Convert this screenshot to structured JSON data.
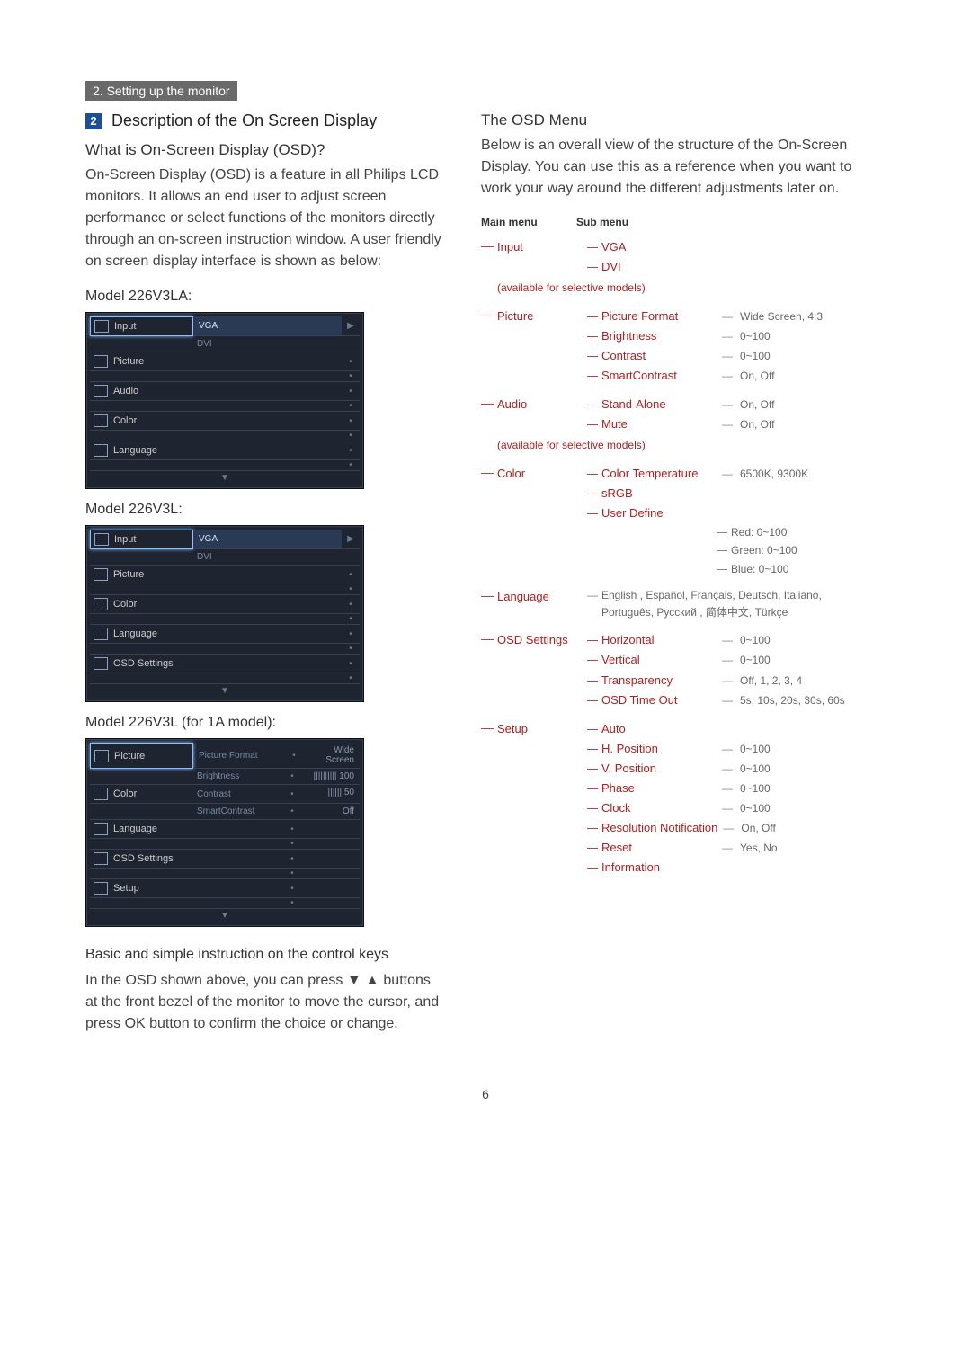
{
  "header": "2. Setting up the monitor",
  "section_number": "2",
  "section_title": "Description of the On Screen Display",
  "left": {
    "q_heading": "What is On-Screen Display (OSD)?",
    "q_body": "On-Screen Display (OSD) is a feature in all Philips LCD monitors. It allows an end user to adjust screen performance or select functions of the monitors directly through an on-screen instruction window. A user friendly on screen display interface is shown as below:",
    "model_a": "Model 226V3LA:",
    "model_b": "Model 226V3L:",
    "model_c": "Model 226V3L (for 1A model):",
    "osd_a": {
      "rows": [
        {
          "icon": true,
          "label": "Input",
          "right": "VGA",
          "active": true
        },
        {
          "icon": false,
          "label": "",
          "right": "DVI"
        },
        {
          "icon": true,
          "label": "Picture",
          "right": ""
        },
        {
          "icon": false,
          "label": "",
          "right": ""
        },
        {
          "icon": true,
          "label": "Audio",
          "right": ""
        },
        {
          "icon": false,
          "label": "",
          "right": ""
        },
        {
          "icon": true,
          "label": "Color",
          "right": ""
        },
        {
          "icon": false,
          "label": "",
          "right": ""
        },
        {
          "icon": true,
          "label": "Language",
          "right": ""
        },
        {
          "icon": false,
          "label": "",
          "right": ""
        }
      ]
    },
    "osd_b": {
      "rows": [
        {
          "icon": true,
          "label": "Input",
          "right": "VGA",
          "active": true
        },
        {
          "icon": false,
          "label": "",
          "right": "DVI"
        },
        {
          "icon": true,
          "label": "Picture",
          "right": ""
        },
        {
          "icon": false,
          "label": "",
          "right": ""
        },
        {
          "icon": true,
          "label": "Color",
          "right": ""
        },
        {
          "icon": false,
          "label": "",
          "right": ""
        },
        {
          "icon": true,
          "label": "Language",
          "right": ""
        },
        {
          "icon": false,
          "label": "",
          "right": ""
        },
        {
          "icon": true,
          "label": "OSD Settings",
          "right": ""
        },
        {
          "icon": false,
          "label": "",
          "right": ""
        }
      ]
    },
    "osd_c": {
      "rows": [
        {
          "left": "Picture",
          "r1": "Picture Format",
          "val": "Wide Screen",
          "active": true
        },
        {
          "left": "",
          "r1": "Brightness",
          "val": "||||||||||  100"
        },
        {
          "left": "Color",
          "r1": "Contrast",
          "val": "||||||          50"
        },
        {
          "left": "",
          "r1": "SmartContrast",
          "val": "Off"
        },
        {
          "left": "Language",
          "r1": "",
          "val": ""
        },
        {
          "left": "",
          "r1": "",
          "val": ""
        },
        {
          "left": "OSD Settings",
          "r1": "",
          "val": ""
        },
        {
          "left": "",
          "r1": "",
          "val": ""
        },
        {
          "left": "Setup",
          "r1": "",
          "val": ""
        },
        {
          "left": "",
          "r1": "",
          "val": ""
        }
      ]
    },
    "instr_heading": "Basic and simple instruction on the control keys",
    "instr_body_1": "In the OSD shown above, you can press ▼",
    "instr_body_2": "▲ buttons at the front bezel of the monitor to move the cursor, and press OK button to confirm the choice or change."
  },
  "right": {
    "heading": "The OSD Menu",
    "body": "Below is an overall view of the structure of the On-Screen Display. You can use this as a reference when you want to work your way around the different adjustments later on.",
    "tree_head_main": "Main menu",
    "tree_head_sub": "Sub menu",
    "tree": [
      {
        "main": "Input",
        "subs": [
          {
            "label": "VGA"
          },
          {
            "label": "DVI"
          }
        ],
        "note": "(available for selective models)"
      },
      {
        "main": "Picture",
        "subs": [
          {
            "label": "Picture Format",
            "val": "Wide Screen, 4:3"
          },
          {
            "label": "Brightness",
            "val": "0~100"
          },
          {
            "label": "Contrast",
            "val": "0~100"
          },
          {
            "label": "SmartContrast",
            "val": "On, Off"
          }
        ]
      },
      {
        "main": "Audio",
        "subs": [
          {
            "label": "Stand-Alone",
            "val": "On, Off"
          },
          {
            "label": "Mute",
            "val": "On, Off"
          }
        ],
        "note": "(available for selective models)"
      },
      {
        "main": "Color",
        "subs": [
          {
            "label": "Color Temperature",
            "val": "6500K, 9300K"
          },
          {
            "label": "sRGB"
          },
          {
            "label": "User Define",
            "ud": [
              "Red: 0~100",
              "Green: 0~100",
              "Blue: 0~100"
            ]
          }
        ]
      },
      {
        "main": "Language",
        "lang": "English , Español, Français, Deutsch, Italiano, Português, Русский , 简体中文, Türkçe"
      },
      {
        "main": "OSD Settings",
        "subs": [
          {
            "label": "Horizontal",
            "val": "0~100"
          },
          {
            "label": "Vertical",
            "val": "0~100"
          },
          {
            "label": "Transparency",
            "val": "Off, 1, 2, 3, 4"
          },
          {
            "label": "OSD Time Out",
            "val": "5s, 10s, 20s, 30s, 60s"
          }
        ]
      },
      {
        "main": "Setup",
        "subs": [
          {
            "label": "Auto"
          },
          {
            "label": "H. Position",
            "val": "0~100"
          },
          {
            "label": "V. Position",
            "val": "0~100"
          },
          {
            "label": "Phase",
            "val": "0~100"
          },
          {
            "label": "Clock",
            "val": "0~100"
          },
          {
            "label": "Resolution Notification",
            "val": "On, Off"
          },
          {
            "label": "Reset",
            "val": "Yes, No"
          },
          {
            "label": "Information"
          }
        ]
      }
    ]
  },
  "page_number": "6"
}
